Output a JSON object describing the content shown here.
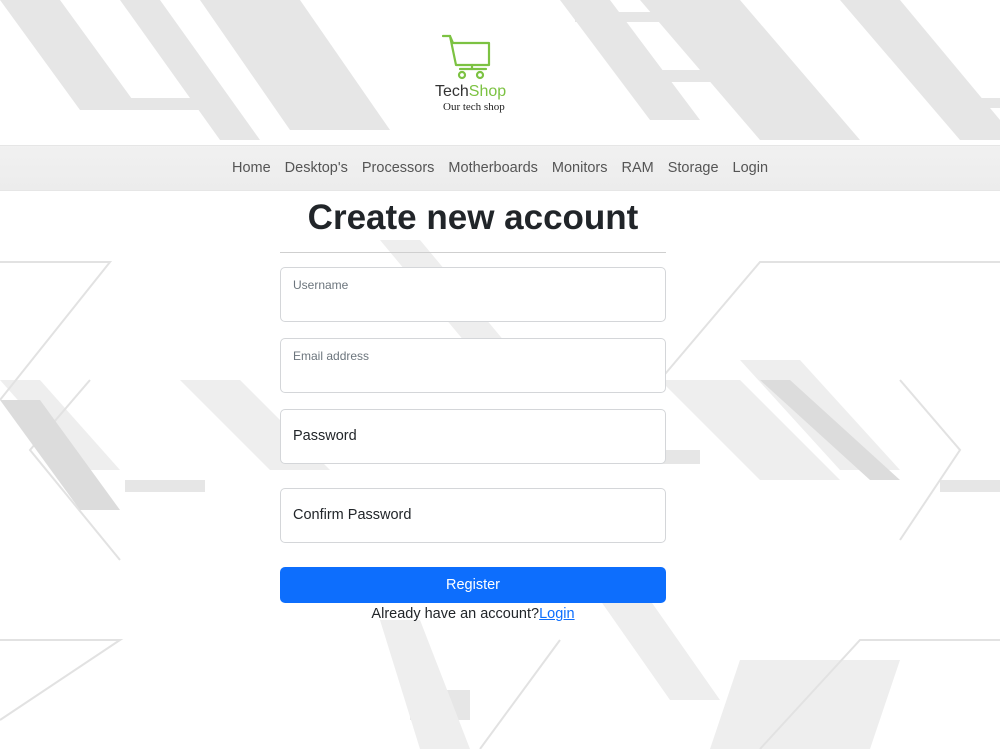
{
  "brand": {
    "name_part1": "Tech",
    "name_part2": "Shop",
    "tagline": "Our tech shop",
    "accent_color": "#7cc242",
    "logo_icon": "shopping-cart-monitor-icon"
  },
  "nav": {
    "items": [
      {
        "label": "Home"
      },
      {
        "label": "Desktop's"
      },
      {
        "label": "Processors"
      },
      {
        "label": "Motherboards"
      },
      {
        "label": "Monitors"
      },
      {
        "label": "RAM"
      },
      {
        "label": "Storage"
      },
      {
        "label": "Login"
      }
    ]
  },
  "form": {
    "title": "Create new account",
    "username_label": "Username",
    "username_value": "",
    "email_label": "Email address",
    "email_value": "",
    "password_label": "Password",
    "confirm_password_label": "Confirm Password",
    "register_label": "Register",
    "register_color": "#0d6efd",
    "have_account_text": "Already have an account?",
    "login_link": "Login"
  }
}
